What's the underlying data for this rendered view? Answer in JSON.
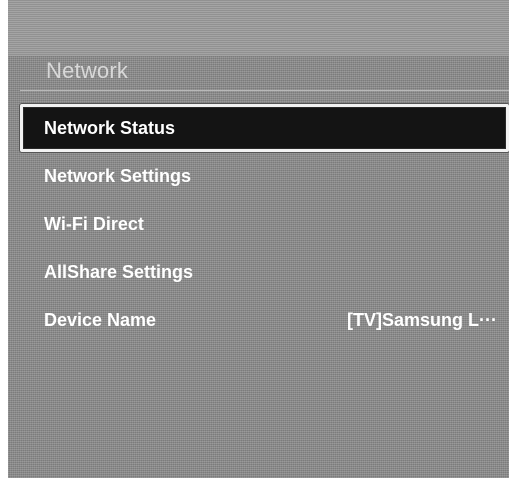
{
  "menu": {
    "title": "Network",
    "items": [
      {
        "label": "Network Status",
        "value": "",
        "selected": true
      },
      {
        "label": "Network Settings",
        "value": ""
      },
      {
        "label": "Wi-Fi Direct",
        "value": ""
      },
      {
        "label": "AllShare Settings",
        "value": ""
      },
      {
        "label": "Device Name",
        "value": "[TV]Samsung L···"
      }
    ]
  },
  "colors": {
    "panel_background": "#8c8c8c",
    "selection_background": "#141414",
    "selection_border": "#f2f2f2",
    "text": "#ffffff"
  }
}
